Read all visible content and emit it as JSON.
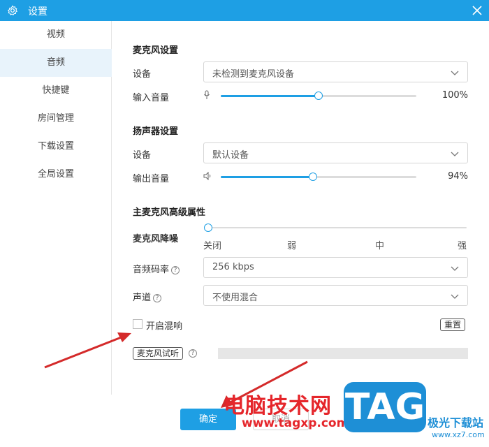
{
  "window": {
    "title": "设置"
  },
  "sidebar": {
    "items": [
      {
        "label": "视频"
      },
      {
        "label": "音频"
      },
      {
        "label": "快捷键"
      },
      {
        "label": "房间管理"
      },
      {
        "label": "下载设置"
      },
      {
        "label": "全局设置"
      }
    ],
    "active_index": 1
  },
  "mic": {
    "title": "麦克风设置",
    "device_label": "设备",
    "device_value": "未检测到麦克风设备",
    "volume_label": "输入音量",
    "volume_text": "100%",
    "volume_fraction": 0.5
  },
  "speaker": {
    "title": "扬声器设置",
    "device_label": "设备",
    "device_value": "默认设备",
    "volume_label": "输出音量",
    "volume_text": "94%",
    "volume_fraction": 0.47
  },
  "advanced": {
    "title": "主麦克风高级属性",
    "noise_label": "麦克风降噪",
    "noise_levels": [
      "关闭",
      "弱",
      "中",
      "强"
    ],
    "noise_selected": "关闭",
    "bitrate_label": "音频码率",
    "bitrate_value": "256 kbps",
    "channel_label": "声道",
    "channel_value": "不使用混合",
    "reverb_label": "开启混响",
    "reverb_checked": false,
    "reset_label": "重置",
    "mic_test_label": "麦克风试听"
  },
  "footer": {
    "ok_label": "确定",
    "cancel_label": "取消"
  },
  "watermark": {
    "site_name": "电脑技术网",
    "url": "www.tagxp.com",
    "logo": "TAG",
    "side_name": "极光下载站",
    "side_url": "www.xz7.com"
  },
  "colors": {
    "accent": "#1e9fe4",
    "titlebar": "#1e9fe4",
    "arrow": "#d42a2a"
  }
}
